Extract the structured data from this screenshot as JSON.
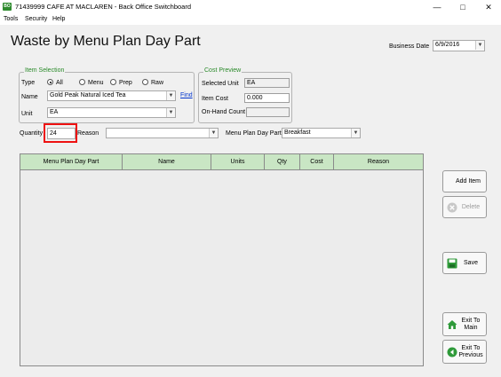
{
  "window": {
    "title": "71439999 CAFE AT MACLAREN - Back Office Switchboard",
    "minimize_glyph": "—",
    "maximize_glyph": "□",
    "close_glyph": "✕"
  },
  "menu": [
    "Tools",
    "Security",
    "Help"
  ],
  "page": {
    "title": "Waste by Menu Plan Day Part"
  },
  "business_date": {
    "label": "Business Date",
    "value": "6/9/2016"
  },
  "item_selection": {
    "caption": "Item Selection",
    "type_label": "Type",
    "types": [
      "All",
      "Menu",
      "Prep",
      "Raw"
    ],
    "selected_type": "All",
    "name_label": "Name",
    "name_value": "Gold Peak Natural Iced Tea",
    "find_link": "Find",
    "unit_label": "Unit",
    "unit_value": "EA"
  },
  "cost_preview": {
    "caption": "Cost Preview",
    "selected_unit_label": "Selected Unit",
    "selected_unit_value": "EA",
    "item_cost_label": "Item Cost",
    "item_cost_value": "0.000",
    "on_hand_label": "On-Hand Count",
    "on_hand_value": ""
  },
  "entry": {
    "quantity_label": "Quantity",
    "quantity_value": "24",
    "reason_label": "Reason",
    "reason_value": "",
    "day_part_label": "Menu Plan Day Part",
    "day_part_value": "Breakfast"
  },
  "grid": {
    "columns": [
      "Menu Plan Day Part",
      "Name",
      "Units",
      "Qty",
      "Cost",
      "Reason"
    ],
    "rows": []
  },
  "buttons": {
    "add_item": "Add Item",
    "delete": "Delete",
    "save": "Save",
    "exit_main_line1": "Exit To",
    "exit_main_line2": "Main",
    "exit_prev_line1": "Exit To",
    "exit_prev_line2": "Previous"
  },
  "colors": {
    "accent_green": "#2a8a2a",
    "grid_header": "#c9e6c4",
    "highlight_red": "#e11111"
  }
}
